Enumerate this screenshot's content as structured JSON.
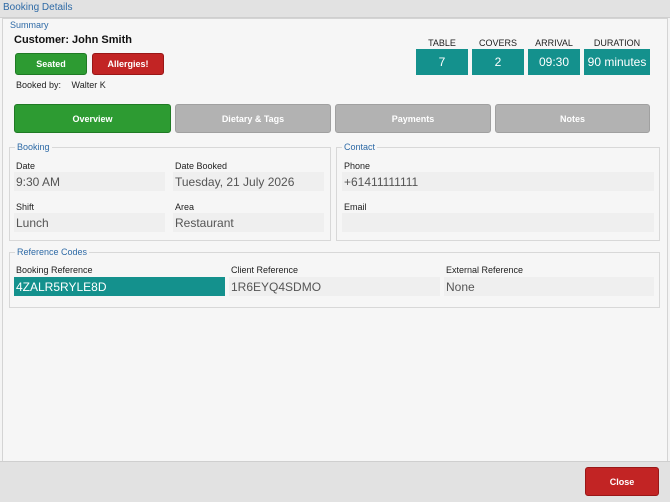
{
  "window": {
    "title": "Booking Details"
  },
  "summary": {
    "label": "Summary",
    "customer": "Customer: John Smith",
    "seated_label": "Seated",
    "allergies_label": "Allergies!",
    "booked_by_label": "Booked by:",
    "booked_by_value": "Walter K",
    "stats": [
      {
        "header": "TABLE",
        "value": "7"
      },
      {
        "header": "COVERS",
        "value": "2"
      },
      {
        "header": "ARRIVAL",
        "value": "09:30"
      },
      {
        "header": "DURATION",
        "value": "90 minutes"
      }
    ]
  },
  "tabs": [
    {
      "label": "Overview",
      "active": true
    },
    {
      "label": "Dietary & Tags",
      "active": false
    },
    {
      "label": "Payments",
      "active": false
    },
    {
      "label": "Notes",
      "active": false
    }
  ],
  "booking": {
    "label": "Booking",
    "date_label": "Date",
    "date_value": "9:30 AM",
    "date_booked_label": "Date Booked",
    "date_booked_value": "Tuesday, 21 July 2026",
    "shift_label": "Shift",
    "shift_value": "Lunch",
    "area_label": "Area",
    "area_value": "Restaurant"
  },
  "contact": {
    "label": "Contact",
    "phone_label": "Phone",
    "phone_value": "+61411111111",
    "email_label": "Email",
    "email_value": ""
  },
  "reference": {
    "label": "Reference Codes",
    "booking_ref_label": "Booking Reference",
    "booking_ref_value": "4ZALR5RYLE8D",
    "client_ref_label": "Client Reference",
    "client_ref_value": "1R6EYQ4SDMO",
    "external_ref_label": "External Reference",
    "external_ref_value": "None"
  },
  "footer": {
    "close_label": "Close"
  },
  "colors": {
    "accent_teal": "#14918d",
    "green": "#2d9b32",
    "red": "#c22424",
    "section_blue": "#2e6aa6"
  }
}
